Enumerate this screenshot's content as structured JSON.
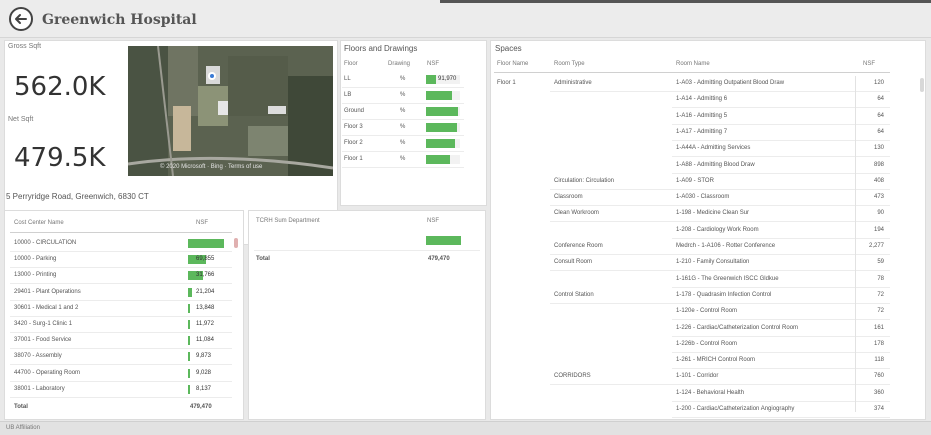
{
  "header": {
    "title": "Greenwich Hospital"
  },
  "kpis": {
    "gross_sqft": {
      "label": "Gross Sqft",
      "value": "562.0K"
    },
    "net_sqft": {
      "label": "Net Sqft",
      "value": "479.5K"
    }
  },
  "map": {
    "caption": "© 2020 Microsoft · Bing · Terms of use"
  },
  "address": "5 Perryridge Road, Greenwich, 6830 CT",
  "floors": {
    "title": "Floors and Drawings",
    "headers": [
      "Floor",
      "Drawing",
      "NSF"
    ],
    "rows": [
      {
        "floor": "LL",
        "drawing": "%",
        "nsf": "91,970",
        "fill": 0.3
      },
      {
        "floor": "LB",
        "drawing": "%",
        "nsf": "",
        "fill": 0.75
      },
      {
        "floor": "Ground",
        "drawing": "%",
        "nsf": "",
        "fill": 0.95
      },
      {
        "floor": "Floor 3",
        "drawing": "%",
        "nsf": "",
        "fill": 0.9
      },
      {
        "floor": "Floor 2",
        "drawing": "%",
        "nsf": "",
        "fill": 0.85
      },
      {
        "floor": "Floor 1",
        "drawing": "%",
        "nsf": "",
        "fill": 0.7
      }
    ]
  },
  "spaces_title": "Spaces",
  "spaces_headers": [
    "Floor Name",
    "Room Type",
    "Room Name",
    "NSF"
  ],
  "spaces_floor": "Floor 1",
  "spaces": [
    {
      "type": "Administrative",
      "name": "1-A03 - Admitting Outpatient Blood Draw",
      "nsf": "120"
    },
    {
      "type": "",
      "name": "1-A14 - Admitting 6",
      "nsf": "64"
    },
    {
      "type": "",
      "name": "1-A16 - Admitting 5",
      "nsf": "64"
    },
    {
      "type": "",
      "name": "1-A17 - Admitting 7",
      "nsf": "64"
    },
    {
      "type": "",
      "name": "1-A44A - Admitting Services",
      "nsf": "130"
    },
    {
      "type": "",
      "name": "1-A88 - Admitting Blood Draw",
      "nsf": "898"
    },
    {
      "type": "Circulation: Circulation",
      "name": "1-A09 - STOR",
      "nsf": "408"
    },
    {
      "type": "Classroom",
      "name": "1-A030 - Classroom",
      "nsf": "473"
    },
    {
      "type": "Clean Workroom",
      "name": "1-198 - Medicine Clean Sur",
      "nsf": "90"
    },
    {
      "type": "",
      "name": "1-208 - Cardiology Work Room",
      "nsf": "194"
    },
    {
      "type": "Conference Room",
      "name": "Medrch - 1-A106 - Rotter Conference",
      "nsf": "2,277"
    },
    {
      "type": "Consult Room",
      "name": "1-210 - Family Consultation",
      "nsf": "59"
    },
    {
      "type": "",
      "name": "1-161G - The Greenwich ISCC Gldkue",
      "nsf": "78"
    },
    {
      "type": "Control Station",
      "name": "1-178 - Quadrasim Infection Control",
      "nsf": "72"
    },
    {
      "type": "",
      "name": "1-120e - Control Room",
      "nsf": "72"
    },
    {
      "type": "",
      "name": "1-226 - Cardiac/Catheterization Control Room",
      "nsf": "161"
    },
    {
      "type": "",
      "name": "1-226b - Control Room",
      "nsf": "178"
    },
    {
      "type": "",
      "name": "1-261 - MRICH Control Room",
      "nsf": "118"
    },
    {
      "type": "CORRIDORS",
      "name": "1-101 - Corridor",
      "nsf": "760"
    },
    {
      "type": "",
      "name": "1-124 - Behavioral Health",
      "nsf": "360"
    },
    {
      "type": "",
      "name": "1-200 - Cardiac/Catheterization Angiography",
      "nsf": "374"
    }
  ],
  "cost_centers": {
    "headers": [
      "Cost Center Name",
      "NSF"
    ],
    "rows": [
      {
        "name": "10000 - CIRCULATION",
        "value": "",
        "fill": 1.0
      },
      {
        "name": "10000 - Parking",
        "value": "69,855",
        "fill": 0.5
      },
      {
        "name": "13000 - Printing",
        "value": "31,766",
        "fill": 0.42
      },
      {
        "name": "29401 - Plant Operations",
        "value": "21,204",
        "fill": 0.12
      },
      {
        "name": "30601 - Medical 1 and 2",
        "value": "13,848",
        "fill": 0.06
      },
      {
        "name": "3420 - Surg-1 Clinic 1",
        "value": "11,972",
        "fill": 0.05
      },
      {
        "name": "37001 - Food Service",
        "value": "11,084",
        "fill": 0.05
      },
      {
        "name": "38070 - Assembly",
        "value": "9,873",
        "fill": 0.04
      },
      {
        "name": "44700 - Operating Room",
        "value": "9,028",
        "fill": 0.04
      },
      {
        "name": "38001 - Laboratory",
        "value": "8,137",
        "fill": 0.035
      }
    ],
    "total_label": "Total",
    "total_value": "479,470"
  },
  "department": {
    "headers": [
      "TCRH Sum Department",
      "NSF"
    ],
    "rows": [
      {
        "name": "",
        "value": ""
      }
    ],
    "total_label": "Total",
    "total_value": "479,470"
  },
  "status_bar": "UB Affiliation",
  "colors": {
    "accent": "#5cb85c"
  }
}
